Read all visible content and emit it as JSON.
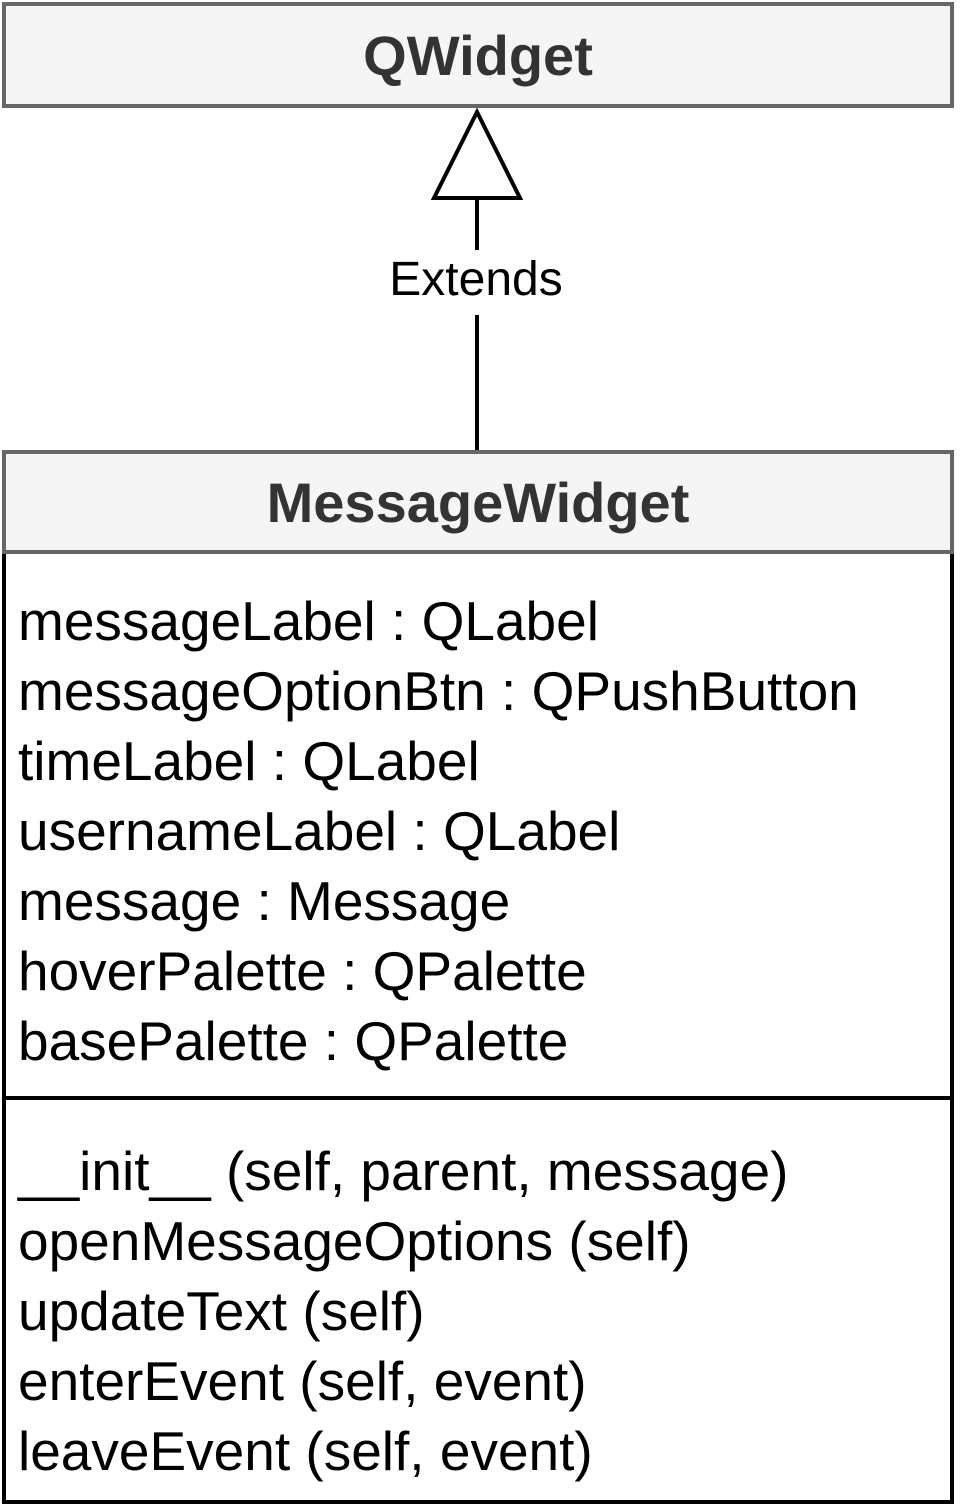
{
  "parent_class": {
    "name": "QWidget"
  },
  "relationship": {
    "label": "Extends"
  },
  "child_class": {
    "name": "MessageWidget",
    "attributes": [
      "messageLabel : QLabel",
      "messageOptionBtn : QPushButton",
      "timeLabel : QLabel",
      "usernameLabel : QLabel",
      "message : Message",
      "hoverPalette : QPalette",
      "basePalette : QPalette"
    ],
    "methods": [
      "__init__ (self, parent, message)",
      "openMessageOptions (self)",
      "updateText (self)",
      "enterEvent (self, event)",
      "leaveEvent (self, event)"
    ]
  },
  "colors": {
    "header_fill": "#f5f5f5",
    "header_border": "#666666",
    "header_text": "#333333",
    "line": "#000000"
  }
}
